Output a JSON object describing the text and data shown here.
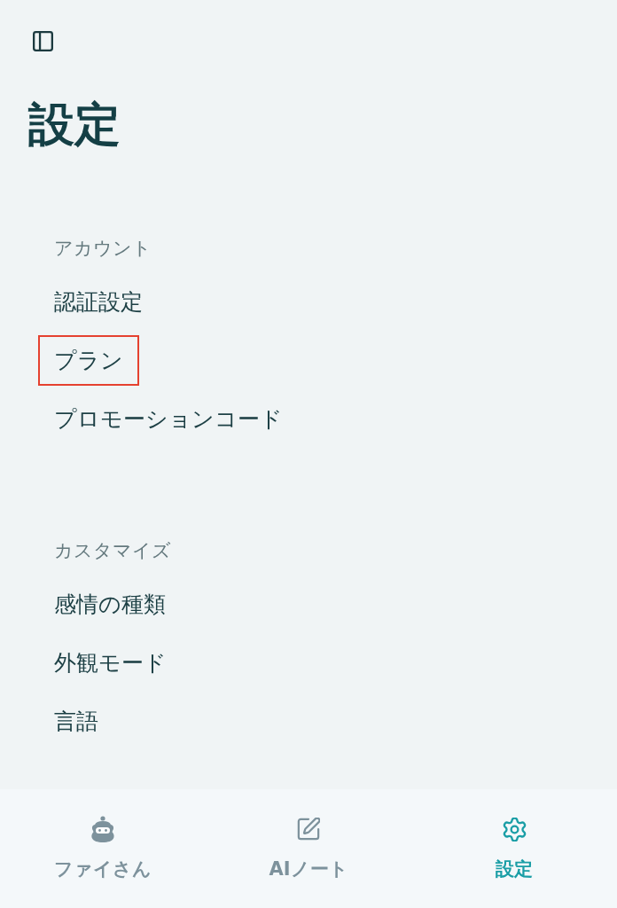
{
  "title": "設定",
  "sections": [
    {
      "heading": "アカウント",
      "items": [
        {
          "label": "認証設定",
          "highlighted": false
        },
        {
          "label": "プラン",
          "highlighted": true
        },
        {
          "label": "プロモーションコード",
          "highlighted": false
        }
      ]
    },
    {
      "heading": "カスタマイズ",
      "items": [
        {
          "label": "感情の種類",
          "highlighted": false
        },
        {
          "label": "外観モード",
          "highlighted": false
        },
        {
          "label": "言語",
          "highlighted": false
        }
      ]
    }
  ],
  "tab_bar": {
    "tabs": [
      {
        "kind": "assistant",
        "label": "ファイさん",
        "selected": false
      },
      {
        "kind": "note",
        "label": "AIノート",
        "selected": false
      },
      {
        "kind": "settings",
        "label": "設定",
        "selected": true
      }
    ]
  }
}
